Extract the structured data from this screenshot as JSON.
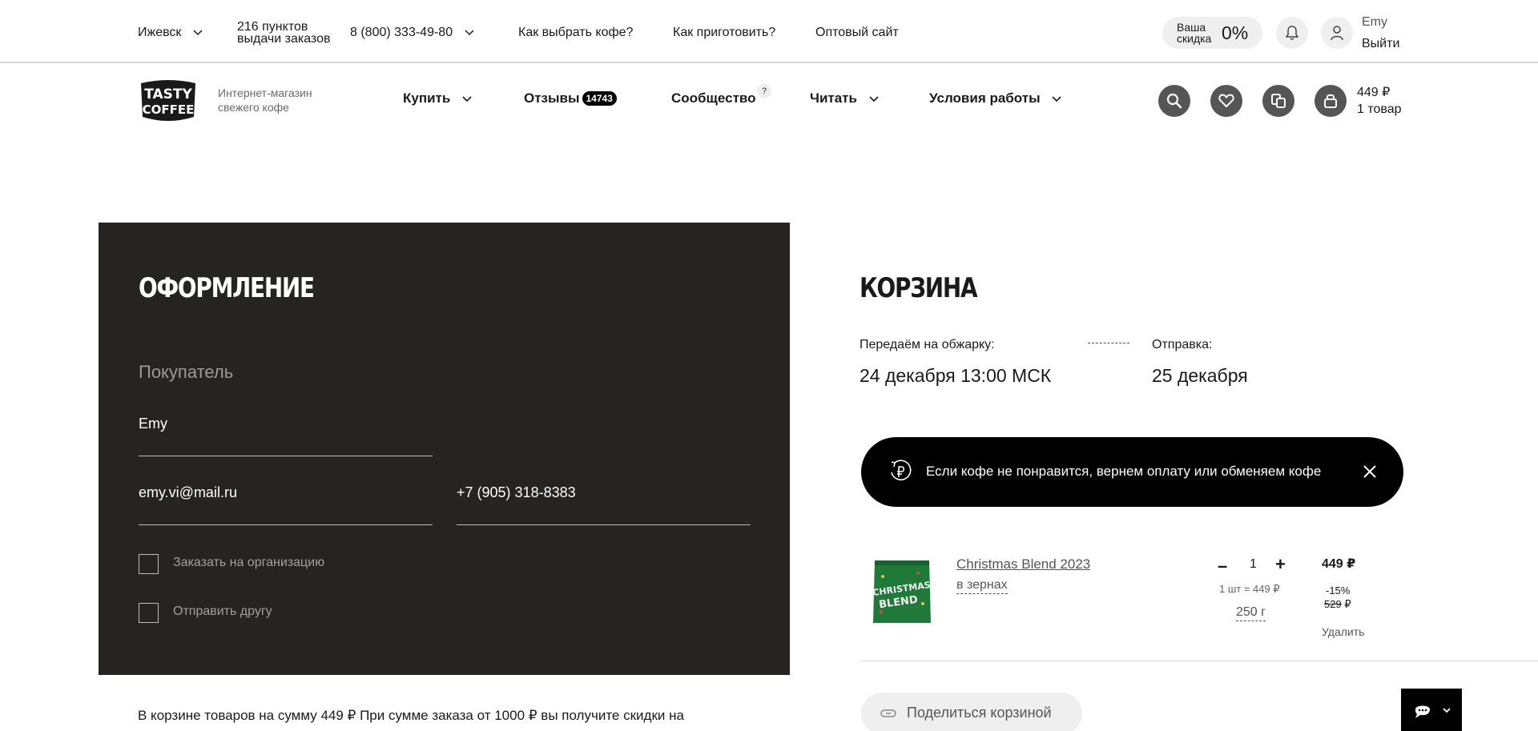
{
  "topbar": {
    "city": "Ижевск",
    "pickup_points": "216 пунктов",
    "pickup_points_sub": "выдачи заказов",
    "phone": "8 (800) 333-49-80",
    "links": [
      "Как выбрать кофе?",
      "Как приготовить?",
      "Оптовый сайт"
    ],
    "discount_label_1": "Ваша",
    "discount_label_2": "скидка",
    "discount_value": "0%",
    "user_name": "Emy",
    "logout": "Выйти",
    "icons": [
      "bell-icon",
      "user-icon"
    ]
  },
  "header": {
    "logo_line1": "TASTY",
    "logo_line2": "COFFEE",
    "tagline_1": "Интернет-магазин",
    "tagline_2": "свежего кофе",
    "nav": {
      "buy": "Купить",
      "reviews": "Отзывы",
      "reviews_count": "14743",
      "community": "Сообщество",
      "community_hint": "?",
      "read": "Читать",
      "terms": "Условия работы"
    },
    "icons": [
      "search-icon",
      "heart-icon",
      "compare-icon",
      "bag-icon"
    ],
    "cart_total": "449 ₽",
    "cart_count": "1 товар"
  },
  "checkout": {
    "title": "ОФОРМЛЕНИЕ",
    "section": "Покупатель",
    "name": "Emy",
    "email": "emy.vi@mail.ru",
    "phone": "+7 (905) 318-8383",
    "org_checkbox": "Заказать на организацию",
    "friend_checkbox": "Отправить другу"
  },
  "summary_text": "В корзине товаров на сумму 449 ₽ При сумме заказа от 1000 ₽ вы получите скидки на",
  "cart": {
    "title": "КОРЗИНА",
    "roast_label": "Передаём на обжарку:",
    "roast_date": "24 декабря 13:00 МСК",
    "ship_label": "Отправка:",
    "ship_date": "25 декабря",
    "promise": "Если кофе не понравится, вернем оплату или обменяем кофе",
    "item": {
      "name": "Christmas Blend 2023",
      "grind": "в зернах",
      "qty": "1",
      "minus": "–",
      "plus": "+",
      "unit_price": "1 шт = 449 ₽",
      "weight": "250 г",
      "price": "449 ₽",
      "discount": "-15%",
      "old_price": "529",
      "old_price_currency": "₽",
      "delete": "Удалить",
      "image_text_1": "CHRISTMAS",
      "image_text_2": "BLEND"
    },
    "share": "Поделиться корзиной"
  },
  "colors": {
    "panel": "#252423",
    "promise_bg": "#000000",
    "icon_dark": "#555555",
    "pill": "#efefef",
    "package_green": "#1f7a3a"
  }
}
